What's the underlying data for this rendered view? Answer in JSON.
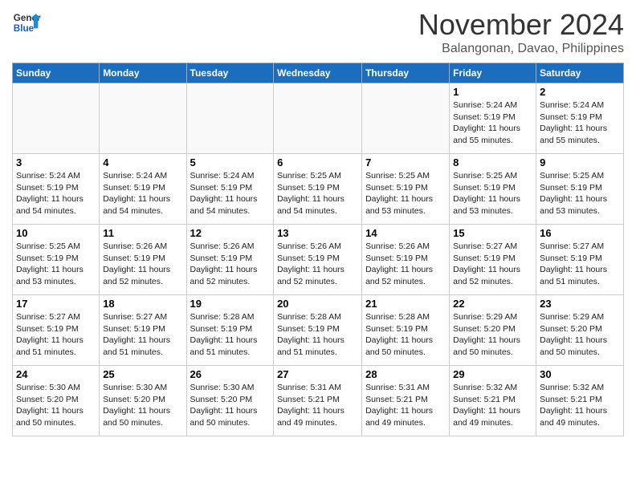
{
  "header": {
    "logo_line1": "General",
    "logo_line2": "Blue",
    "month_title": "November 2024",
    "location": "Balangonan, Davao, Philippines"
  },
  "weekdays": [
    "Sunday",
    "Monday",
    "Tuesday",
    "Wednesday",
    "Thursday",
    "Friday",
    "Saturday"
  ],
  "weeks": [
    [
      {
        "day": "",
        "info": ""
      },
      {
        "day": "",
        "info": ""
      },
      {
        "day": "",
        "info": ""
      },
      {
        "day": "",
        "info": ""
      },
      {
        "day": "",
        "info": ""
      },
      {
        "day": "1",
        "info": "Sunrise: 5:24 AM\nSunset: 5:19 PM\nDaylight: 11 hours and 55 minutes."
      },
      {
        "day": "2",
        "info": "Sunrise: 5:24 AM\nSunset: 5:19 PM\nDaylight: 11 hours and 55 minutes."
      }
    ],
    [
      {
        "day": "3",
        "info": "Sunrise: 5:24 AM\nSunset: 5:19 PM\nDaylight: 11 hours and 54 minutes."
      },
      {
        "day": "4",
        "info": "Sunrise: 5:24 AM\nSunset: 5:19 PM\nDaylight: 11 hours and 54 minutes."
      },
      {
        "day": "5",
        "info": "Sunrise: 5:24 AM\nSunset: 5:19 PM\nDaylight: 11 hours and 54 minutes."
      },
      {
        "day": "6",
        "info": "Sunrise: 5:25 AM\nSunset: 5:19 PM\nDaylight: 11 hours and 54 minutes."
      },
      {
        "day": "7",
        "info": "Sunrise: 5:25 AM\nSunset: 5:19 PM\nDaylight: 11 hours and 53 minutes."
      },
      {
        "day": "8",
        "info": "Sunrise: 5:25 AM\nSunset: 5:19 PM\nDaylight: 11 hours and 53 minutes."
      },
      {
        "day": "9",
        "info": "Sunrise: 5:25 AM\nSunset: 5:19 PM\nDaylight: 11 hours and 53 minutes."
      }
    ],
    [
      {
        "day": "10",
        "info": "Sunrise: 5:25 AM\nSunset: 5:19 PM\nDaylight: 11 hours and 53 minutes."
      },
      {
        "day": "11",
        "info": "Sunrise: 5:26 AM\nSunset: 5:19 PM\nDaylight: 11 hours and 52 minutes."
      },
      {
        "day": "12",
        "info": "Sunrise: 5:26 AM\nSunset: 5:19 PM\nDaylight: 11 hours and 52 minutes."
      },
      {
        "day": "13",
        "info": "Sunrise: 5:26 AM\nSunset: 5:19 PM\nDaylight: 11 hours and 52 minutes."
      },
      {
        "day": "14",
        "info": "Sunrise: 5:26 AM\nSunset: 5:19 PM\nDaylight: 11 hours and 52 minutes."
      },
      {
        "day": "15",
        "info": "Sunrise: 5:27 AM\nSunset: 5:19 PM\nDaylight: 11 hours and 52 minutes."
      },
      {
        "day": "16",
        "info": "Sunrise: 5:27 AM\nSunset: 5:19 PM\nDaylight: 11 hours and 51 minutes."
      }
    ],
    [
      {
        "day": "17",
        "info": "Sunrise: 5:27 AM\nSunset: 5:19 PM\nDaylight: 11 hours and 51 minutes."
      },
      {
        "day": "18",
        "info": "Sunrise: 5:27 AM\nSunset: 5:19 PM\nDaylight: 11 hours and 51 minutes."
      },
      {
        "day": "19",
        "info": "Sunrise: 5:28 AM\nSunset: 5:19 PM\nDaylight: 11 hours and 51 minutes."
      },
      {
        "day": "20",
        "info": "Sunrise: 5:28 AM\nSunset: 5:19 PM\nDaylight: 11 hours and 51 minutes."
      },
      {
        "day": "21",
        "info": "Sunrise: 5:28 AM\nSunset: 5:19 PM\nDaylight: 11 hours and 50 minutes."
      },
      {
        "day": "22",
        "info": "Sunrise: 5:29 AM\nSunset: 5:20 PM\nDaylight: 11 hours and 50 minutes."
      },
      {
        "day": "23",
        "info": "Sunrise: 5:29 AM\nSunset: 5:20 PM\nDaylight: 11 hours and 50 minutes."
      }
    ],
    [
      {
        "day": "24",
        "info": "Sunrise: 5:30 AM\nSunset: 5:20 PM\nDaylight: 11 hours and 50 minutes."
      },
      {
        "day": "25",
        "info": "Sunrise: 5:30 AM\nSunset: 5:20 PM\nDaylight: 11 hours and 50 minutes."
      },
      {
        "day": "26",
        "info": "Sunrise: 5:30 AM\nSunset: 5:20 PM\nDaylight: 11 hours and 50 minutes."
      },
      {
        "day": "27",
        "info": "Sunrise: 5:31 AM\nSunset: 5:21 PM\nDaylight: 11 hours and 49 minutes."
      },
      {
        "day": "28",
        "info": "Sunrise: 5:31 AM\nSunset: 5:21 PM\nDaylight: 11 hours and 49 minutes."
      },
      {
        "day": "29",
        "info": "Sunrise: 5:32 AM\nSunset: 5:21 PM\nDaylight: 11 hours and 49 minutes."
      },
      {
        "day": "30",
        "info": "Sunrise: 5:32 AM\nSunset: 5:21 PM\nDaylight: 11 hours and 49 minutes."
      }
    ]
  ]
}
